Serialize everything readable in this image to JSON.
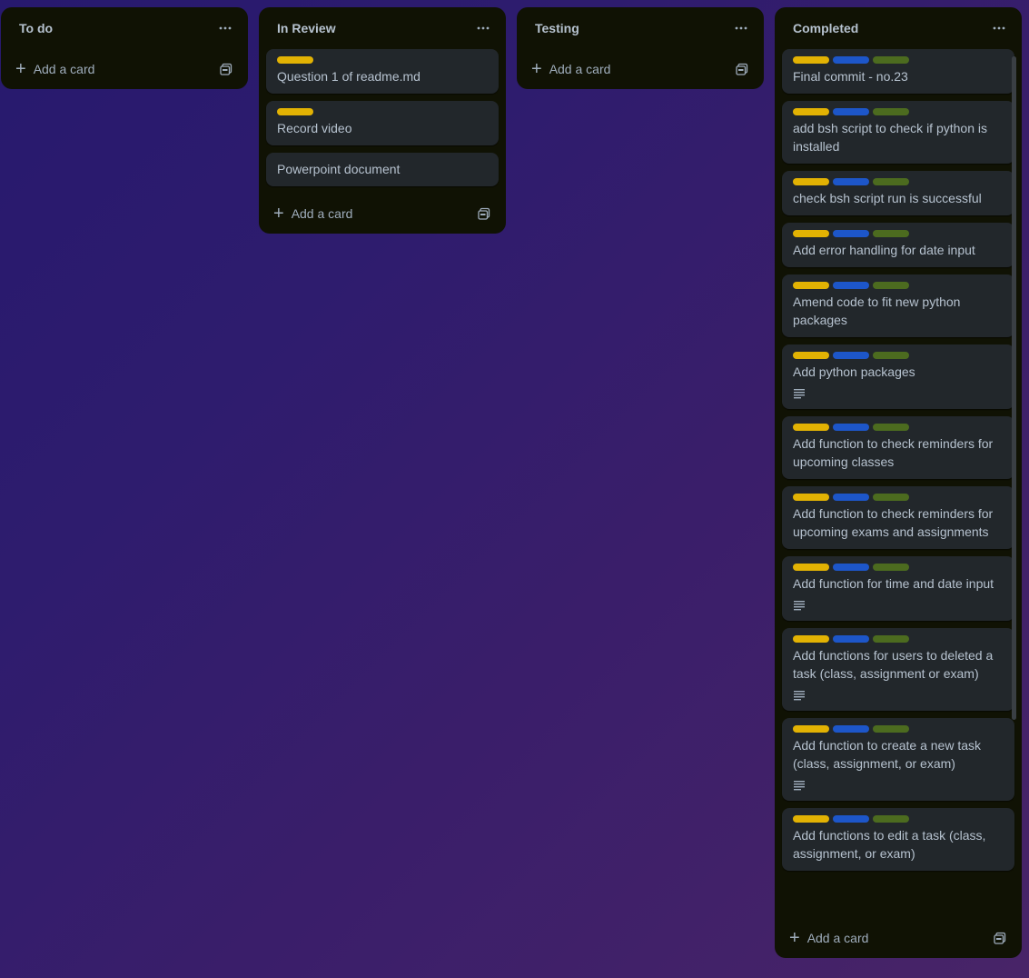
{
  "colors": {
    "yellow": "#e2b203",
    "blue": "#1d56c9",
    "green": "#4c6b1f"
  },
  "lists": [
    {
      "title": "To do",
      "add_label": "Add a card",
      "cards": []
    },
    {
      "title": "In Review",
      "add_label": "Add a card",
      "cards": [
        {
          "title": "Question 1 of readme.md",
          "labels": [
            "yellow"
          ],
          "has_description": false
        },
        {
          "title": "Record video",
          "labels": [
            "yellow"
          ],
          "has_description": false
        },
        {
          "title": "Powerpoint document",
          "labels": [],
          "has_description": false
        }
      ]
    },
    {
      "title": "Testing",
      "add_label": "Add a card",
      "cards": []
    },
    {
      "title": "Completed",
      "add_label": "Add a card",
      "cards": [
        {
          "title": "Final commit - no.23",
          "labels": [
            "yellow",
            "blue",
            "green"
          ],
          "has_description": false
        },
        {
          "title": "add bsh script to check if python is installed",
          "labels": [
            "yellow",
            "blue",
            "green"
          ],
          "has_description": false
        },
        {
          "title": "check bsh script run is successful",
          "labels": [
            "yellow",
            "blue",
            "green"
          ],
          "has_description": false
        },
        {
          "title": "Add error handling for date input",
          "labels": [
            "yellow",
            "blue",
            "green"
          ],
          "has_description": false
        },
        {
          "title": "Amend code to fit new python packages",
          "labels": [
            "yellow",
            "blue",
            "green"
          ],
          "has_description": false
        },
        {
          "title": "Add python packages",
          "labels": [
            "yellow",
            "blue",
            "green"
          ],
          "has_description": true
        },
        {
          "title": "Add function to check reminders for upcoming classes",
          "labels": [
            "yellow",
            "blue",
            "green"
          ],
          "has_description": false
        },
        {
          "title": "Add function to check reminders for upcoming exams and assignments",
          "labels": [
            "yellow",
            "blue",
            "green"
          ],
          "has_description": false
        },
        {
          "title": "Add function for time and date input",
          "labels": [
            "yellow",
            "blue",
            "green"
          ],
          "has_description": true
        },
        {
          "title": "Add functions for users to deleted a task (class, assignment or exam)",
          "labels": [
            "yellow",
            "blue",
            "green"
          ],
          "has_description": true
        },
        {
          "title": "Add function to create a new task (class, assignment, or exam)",
          "labels": [
            "yellow",
            "blue",
            "green"
          ],
          "has_description": true
        },
        {
          "title": "Add functions to edit a task (class, assignment, or exam)",
          "labels": [
            "yellow",
            "blue",
            "green"
          ],
          "has_description": false
        }
      ]
    }
  ]
}
